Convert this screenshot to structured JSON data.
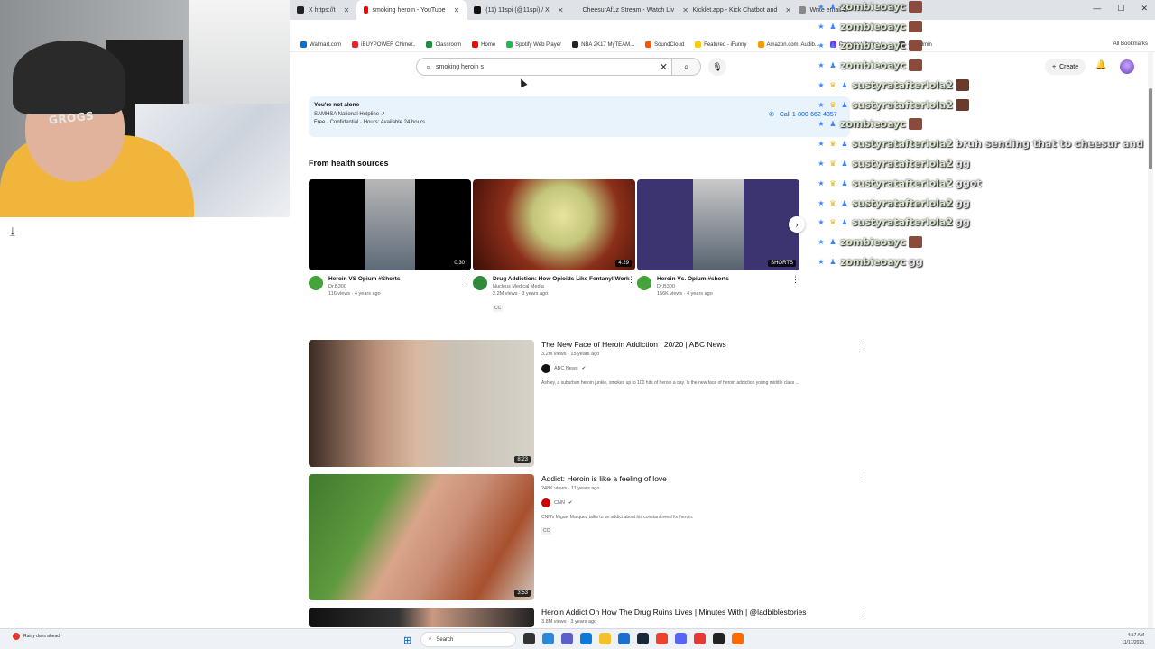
{
  "browser": {
    "tabs": [
      {
        "label": "X https://t",
        "color": "#222222",
        "active": false
      },
      {
        "label": "smoking heroin - YouTube",
        "color": "#ff0000",
        "active": true
      },
      {
        "label": "(11) 11spi (@11spi) / X",
        "color": "#111111",
        "active": false
      },
      {
        "label": "CheesurAf1z Stream - Watch Liv",
        "color": "#53fc18",
        "active": false
      },
      {
        "label": "Kicklet.app - Kick Chatbot and",
        "color": "#00c060",
        "active": false
      },
      {
        "label": "Write email to",
        "color": "#888888",
        "active": false
      }
    ],
    "bookmarks": [
      "Walmart.com",
      "iBUYPOWER Chimer..",
      "Classroom",
      "Home",
      "Spotify Web Player",
      "NBA 2K17 MyTEAM...",
      "SoundCloud",
      "Featured - iFunny",
      "Amazon.com: Audib...",
      "Protopie | Online L...",
      "gm.admin"
    ],
    "all_bookmarks": "All Bookmarks"
  },
  "youtube": {
    "search_value": "smoking heroin s",
    "create_label": "Create",
    "helpline": {
      "title": "You're not alone",
      "org": "SAMHSA National Helpline ↗",
      "detail": "Free · Confidential · Hours: Available 24 hours",
      "call": "Call 1-800-662-4357"
    },
    "health_section_title": "From health sources",
    "shorts": [
      {
        "title": "Heroin VS Opium #Shorts",
        "channel": "Dr.B300",
        "stats": "116 views · 4 years ago",
        "duration": "0:30",
        "extra": ""
      },
      {
        "title": "Drug Addiction: How Opioids Like Fentanyl Work",
        "channel": "Nucleus Medical Media",
        "stats": "2.2M views · 3 years ago",
        "duration": "4:29",
        "extra": "CC"
      },
      {
        "title": "Heroin Vs. Opium #shorts",
        "channel": "Dr.B300",
        "stats": "156K views · 4 years ago",
        "duration": "SHORTS",
        "extra": ""
      }
    ],
    "videos": [
      {
        "title": "The New Face of Heroin Addiction | 20/20 | ABC News",
        "stats": "3.2M views · 15 years ago",
        "channel": "ABC News",
        "channel_color": "#111111",
        "description": "Ashley, a suburban heroin junkie, smokes up to 100 hits of heroin a day. Is the new face of heroin addiction young middle class ...",
        "duration": "8:23",
        "cc": ""
      },
      {
        "title": "Addict: Heroin is like a feeling of love",
        "stats": "248K views · 11 years ago",
        "channel": "CNN",
        "channel_color": "#cc0000",
        "description": "CNN's Miguel Marquez talks to an addict about his constant need for heroin.",
        "duration": "3:53",
        "cc": "CC"
      },
      {
        "title": "Heroin Addict On How The Drug Ruins Lives | Minutes With | @ladbiblestories",
        "stats": "3.8M views · 3 years ago",
        "channel": "",
        "channel_color": "#333333",
        "description": "",
        "duration": "",
        "cc": ""
      }
    ]
  },
  "chat": [
    {
      "user": "zombieoayc",
      "msg": "",
      "badges": [
        "blue",
        "blue"
      ],
      "emote": true
    },
    {
      "user": "zombieoayc",
      "msg": "",
      "badges": [
        "blue",
        "blue"
      ],
      "emote": true
    },
    {
      "user": "zombieoayc",
      "msg": "",
      "badges": [
        "blue",
        "blue"
      ],
      "emote": true
    },
    {
      "user": "zombieoayc",
      "msg": "",
      "badges": [
        "blue",
        "blue"
      ],
      "emote": true
    },
    {
      "user": "sustyratafterlola2",
      "msg": "",
      "badges": [
        "blue",
        "gold",
        "blue"
      ],
      "emote": true
    },
    {
      "user": "sustyratafterlola2",
      "msg": "",
      "badges": [
        "blue",
        "gold",
        "blue"
      ],
      "emote": true
    },
    {
      "user": "zombieoayc",
      "msg": "",
      "badges": [
        "blue",
        "blue"
      ],
      "emote": true
    },
    {
      "user": "sustyratafterlola2",
      "msg": "bruh sending that to cheesur and",
      "badges": [
        "blue",
        "gold",
        "blue"
      ],
      "emote": false
    },
    {
      "user": "sustyratafterlola2",
      "msg": "gg",
      "badges": [
        "blue",
        "gold",
        "blue"
      ],
      "emote": false
    },
    {
      "user": "sustyratafterlola2",
      "msg": "ggot",
      "badges": [
        "blue",
        "gold",
        "blue"
      ],
      "emote": false
    },
    {
      "user": "sustyratafterlola2",
      "msg": "gg",
      "badges": [
        "blue",
        "gold",
        "blue"
      ],
      "emote": false
    },
    {
      "user": "sustyratafterlola2",
      "msg": "gg",
      "badges": [
        "blue",
        "gold",
        "blue"
      ],
      "emote": false
    },
    {
      "user": "zombieoayc",
      "msg": "",
      "badges": [
        "blue",
        "blue"
      ],
      "emote": true
    },
    {
      "user": "zombieoayc",
      "msg": "gg",
      "badges": [
        "blue",
        "blue"
      ],
      "emote": false
    }
  ],
  "webcam": {
    "beanie_text": "GROGS"
  },
  "taskbar": {
    "weather": "Rainy days ahead",
    "search_label": "Search",
    "time": "4:57 AM",
    "date": "11/17/2025"
  }
}
